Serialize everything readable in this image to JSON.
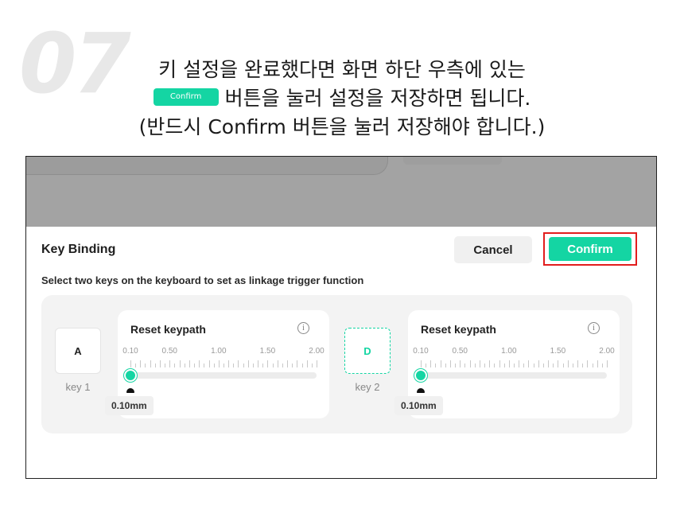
{
  "step_number": "07",
  "instructions": {
    "line1": "키 설정을 완료했다면 화면 하단 우측에 있는",
    "inline_button_label": "Confirm",
    "line2": "버튼을 눌러 설정을 저장하면 됩니다.",
    "line3": "(반드시 Confirm 버튼을 눌러 저장해야 합니다.)"
  },
  "dialog": {
    "title": "Key Binding",
    "cancel_label": "Cancel",
    "confirm_label": "Confirm",
    "subtitle": "Select two keys on the keyboard to set as linkage trigger function"
  },
  "keys": [
    {
      "key": "A",
      "label": "key 1",
      "active": false,
      "card_title": "Reset keypath",
      "value_label": "0.10mm",
      "value": 0.1
    },
    {
      "key": "D",
      "label": "key 2",
      "active": true,
      "card_title": "Reset keypath",
      "value_label": "0.10mm",
      "value": 0.1
    }
  ],
  "scale": {
    "ticks": [
      "0.10",
      "0.50",
      "1.00",
      "1.50",
      "2.00"
    ],
    "min": 0.1,
    "max": 2.0
  },
  "colors": {
    "accent": "#14d5a3",
    "highlight": "#e21d1d",
    "overlay": "#a3a3a3"
  },
  "icons": {
    "info": "info-circle-icon",
    "pointer": "slider-pointer-icon"
  }
}
